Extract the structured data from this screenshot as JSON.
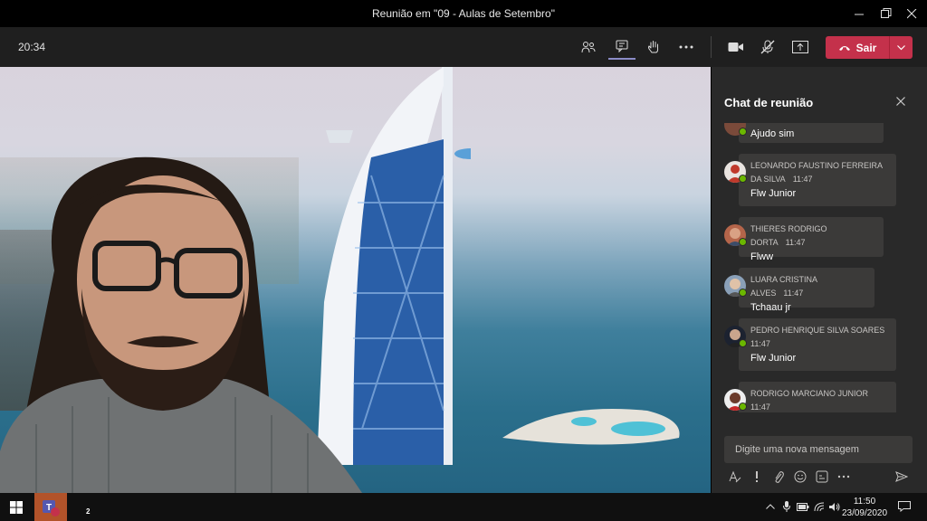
{
  "window": {
    "title": "Reunião em \"09 - Aulas de Setembro\""
  },
  "toolbar": {
    "clock": "20:34",
    "leave_label": "Sair"
  },
  "chat": {
    "title": "Chat de reunião",
    "messages": [
      {
        "sender": "",
        "time": "",
        "text": "Ajudo sim"
      },
      {
        "sender": "LEONARDO FAUSTINO FERREIRA DA SILVA",
        "time": "11:47",
        "text": "Flw Junior"
      },
      {
        "sender": "THIERES RODRIGO DORTA",
        "time": "11:47",
        "text": "Flww"
      },
      {
        "sender": "LUARA CRISTINA ALVES",
        "time": "11:47",
        "text": "Tchaau jr"
      },
      {
        "sender": "PEDRO HENRIQUE SILVA SOARES",
        "time": "11:47",
        "text": "Flw Junior"
      },
      {
        "sender": "RODRIGO MARCIANO JUNIOR",
        "time": "11:47",
        "text": ""
      }
    ],
    "compose_placeholder": "Digite uma nova mensagem"
  },
  "taskbar": {
    "time": "11:50",
    "date": "23/09/2020",
    "teams_badge": "2"
  },
  "colors": {
    "leave": "#c4314b",
    "presence": "#6bb700",
    "panel": "#292929",
    "bubble": "#3b3a39",
    "accent": "#8b8cc7"
  }
}
